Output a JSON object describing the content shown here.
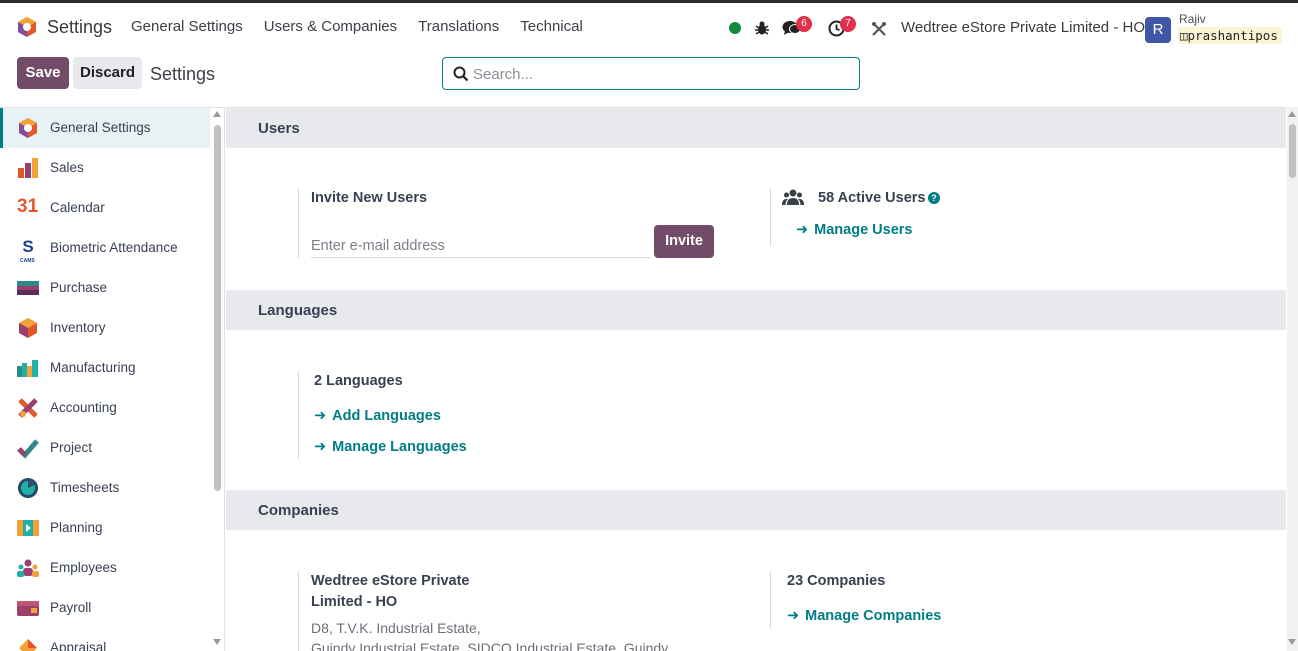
{
  "navbar": {
    "app_title": "Settings",
    "menu": [
      "General Settings",
      "Users & Companies",
      "Translations",
      "Technical"
    ],
    "badges": {
      "messages": "6",
      "activities": "7"
    },
    "company": "Wedtree eStore Private Limited - HO",
    "user": {
      "initial": "R",
      "name": "Rajiv",
      "database": "prashantipos"
    },
    "icons": [
      "status-online-icon",
      "bug-icon",
      "chat-icon",
      "clock-icon",
      "tools-icon"
    ]
  },
  "control": {
    "save_label": "Save",
    "discard_label": "Discard",
    "breadcrumb": "Settings",
    "search_placeholder": "Search..."
  },
  "sidebar": {
    "items": [
      {
        "label": "General Settings",
        "icon": "settings-app-icon"
      },
      {
        "label": "Sales",
        "icon": "sales-app-icon"
      },
      {
        "label": "Calendar",
        "icon": "calendar-app-icon",
        "icon_text": "31"
      },
      {
        "label": "Biometric Attendance",
        "icon": "biometric-app-icon",
        "icon_text": "CAMS"
      },
      {
        "label": "Purchase",
        "icon": "purchase-app-icon"
      },
      {
        "label": "Inventory",
        "icon": "inventory-app-icon"
      },
      {
        "label": "Manufacturing",
        "icon": "manufacturing-app-icon"
      },
      {
        "label": "Accounting",
        "icon": "accounting-app-icon"
      },
      {
        "label": "Project",
        "icon": "project-app-icon"
      },
      {
        "label": "Timesheets",
        "icon": "timesheets-app-icon"
      },
      {
        "label": "Planning",
        "icon": "planning-app-icon"
      },
      {
        "label": "Employees",
        "icon": "employees-app-icon"
      },
      {
        "label": "Payroll",
        "icon": "payroll-app-icon"
      },
      {
        "label": "Appraisal",
        "icon": "appraisal-app-icon"
      }
    ]
  },
  "users": {
    "section_title": "Users",
    "invite_title": "Invite New Users",
    "email_placeholder": "Enter e-mail address",
    "invite_label": "Invite",
    "active_users": "58 Active Users",
    "manage_users": "Manage Users"
  },
  "languages": {
    "section_title": "Languages",
    "count": "2 Languages",
    "add": "Add Languages",
    "manage": "Manage Languages"
  },
  "companies": {
    "section_title": "Companies",
    "name_line1": "Wedtree eStore Private",
    "name_line2": "Limited - HO",
    "address_line1": "D8, T.V.K. Industrial Estate,",
    "address_line2": "Guindy Industrial Estate, SIDCO Industrial Estate, Guindy",
    "count": "23 Companies",
    "manage": "Manage Companies"
  },
  "colors": {
    "primary": "#714b67",
    "link": "#017e84",
    "section_bg": "#e7e9ed"
  }
}
